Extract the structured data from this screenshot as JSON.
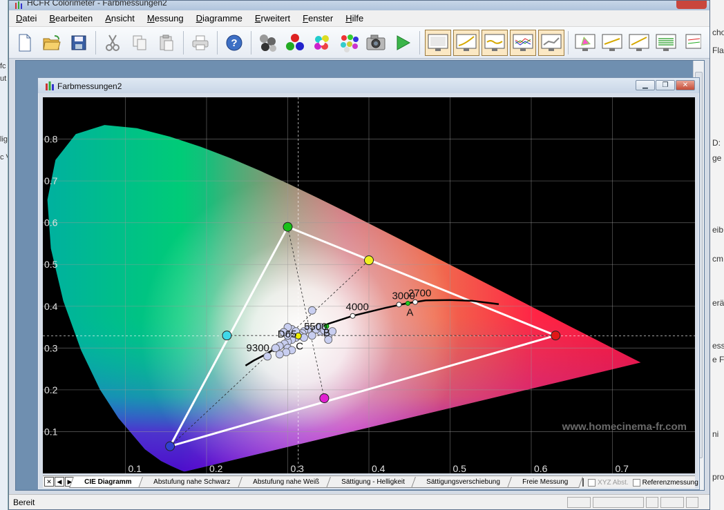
{
  "app": {
    "title": "HCFR Colorimeter - Farbmessungen2"
  },
  "menu": [
    "Datei",
    "Bearbeiten",
    "Ansicht",
    "Messung",
    "Diagramme",
    "Erweitert",
    "Fenster",
    "Hilfe"
  ],
  "toolbar": {
    "icons": [
      "new-file-icon",
      "open-folder-icon",
      "save-icon",
      "cut-icon",
      "copy-icon",
      "paste-icon",
      "print-icon",
      "help-icon",
      "gray-spheres-icon",
      "rgb-spheres-icon",
      "color-spheres-icon",
      "multi-spheres-icon",
      "camera-icon",
      "play-icon",
      "monitor-gray-icon",
      "monitor-curve-icon",
      "monitor-wave-icon",
      "monitor-rgb-icon",
      "monitor-graph-icon",
      "monitor-cie-icon",
      "monitor-yellow-icon",
      "monitor-yellow2-icon",
      "monitor-lines-icon",
      "monitor-partial-icon"
    ]
  },
  "child_window": {
    "title": "Farbmessungen2",
    "buttons": [
      "minimize",
      "restore",
      "close"
    ]
  },
  "chart_data": {
    "type": "scatter",
    "title": "",
    "xlabel": "",
    "ylabel": "",
    "xlim": [
      0.0,
      0.8
    ],
    "ylim": [
      0.0,
      0.9
    ],
    "x_tick_labels": [
      "0.1",
      "0.2",
      "0.3",
      "0.4",
      "0.5",
      "0.6",
      "0.7"
    ],
    "y_tick_labels": [
      "0.1",
      "0.2",
      "0.3",
      "0.4",
      "0.5",
      "0.6",
      "0.7",
      "0.8"
    ],
    "grid": true,
    "gamut_triangle": {
      "red": [
        0.63,
        0.33
      ],
      "green": [
        0.3,
        0.59
      ],
      "blue": [
        0.155,
        0.065
      ]
    },
    "secondaries": {
      "cyan": [
        0.225,
        0.33
      ],
      "magenta": [
        0.345,
        0.18
      ],
      "yellow": [
        0.4,
        0.51
      ]
    },
    "white_point": [
      0.313,
      0.329
    ],
    "temperature_labels": [
      {
        "text": "2700",
        "x": 0.457,
        "y": 0.41
      },
      {
        "text": "3000",
        "x": 0.437,
        "y": 0.404
      },
      {
        "text": "4000",
        "x": 0.38,
        "y": 0.377
      },
      {
        "text": "5500",
        "x": 0.332,
        "y": 0.347
      },
      {
        "text": "9300",
        "x": 0.283,
        "y": 0.297
      }
    ],
    "illuminant_labels": [
      {
        "text": "A",
        "x": 0.448,
        "y": 0.407
      },
      {
        "text": "B",
        "x": 0.348,
        "y": 0.352
      },
      {
        "text": "C",
        "x": 0.31,
        "y": 0.316
      },
      {
        "text": "D65",
        "x": 0.313,
        "y": 0.329
      }
    ],
    "measurements": [
      [
        0.33,
        0.39
      ],
      [
        0.34,
        0.34
      ],
      [
        0.35,
        0.33
      ],
      [
        0.355,
        0.34
      ],
      [
        0.35,
        0.32
      ],
      [
        0.325,
        0.345
      ],
      [
        0.32,
        0.34
      ],
      [
        0.318,
        0.335
      ],
      [
        0.315,
        0.33
      ],
      [
        0.31,
        0.325
      ],
      [
        0.305,
        0.32
      ],
      [
        0.3,
        0.315
      ],
      [
        0.296,
        0.31
      ],
      [
        0.29,
        0.305
      ],
      [
        0.285,
        0.3
      ],
      [
        0.3,
        0.33
      ],
      [
        0.305,
        0.345
      ],
      [
        0.3,
        0.35
      ],
      [
        0.31,
        0.34
      ],
      [
        0.32,
        0.325
      ],
      [
        0.33,
        0.33
      ],
      [
        0.335,
        0.345
      ],
      [
        0.34,
        0.35
      ],
      [
        0.345,
        0.342
      ],
      [
        0.3,
        0.3
      ],
      [
        0.305,
        0.295
      ],
      [
        0.298,
        0.29
      ],
      [
        0.29,
        0.285
      ],
      [
        0.275,
        0.28
      ],
      [
        0.295,
        0.338
      ]
    ],
    "watermark": "www.homecinema-fr.com"
  },
  "tabs": {
    "items": [
      "CIE Diagramm",
      "Abstufung nahe Schwarz",
      "Abstufung nahe Weiß",
      "Sättigung - Helligkeit",
      "Sättigungsverschiebung",
      "Freie Messung"
    ],
    "active": 0,
    "checkboxes": [
      {
        "label": "XYZ Abst.",
        "checked": false,
        "enabled": false
      },
      {
        "label": "Referenzmessung",
        "checked": false,
        "enabled": true
      }
    ]
  },
  "status": {
    "text": "Bereit"
  },
  "background_right": [
    "cho",
    "Fla",
    "D:",
    "ge",
    "eib",
    "cm",
    "erä",
    "ess",
    "e F",
    "ni",
    "pro"
  ],
  "background_left": [
    "fc",
    "ut",
    "lig",
    "c V"
  ]
}
